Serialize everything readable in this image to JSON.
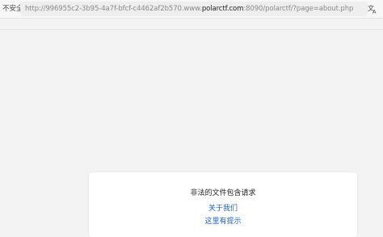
{
  "browser": {
    "security_label": "不安全",
    "url_prefix": "http://996955c2-3b95-4a7f-bfcf-c4462af2b570.www.",
    "url_host": "polarctf.com",
    "url_suffix": ":8090/polarctf/?page=about.php",
    "translate_icon": "translate-icon"
  },
  "page": {
    "heading": "非法的文件包含请求",
    "links": [
      {
        "label": "关于我们"
      },
      {
        "label": "这里有提示"
      }
    ]
  },
  "colors": {
    "link": "#1a5fd6",
    "background": "#f3f3f3",
    "card": "#ffffff"
  }
}
